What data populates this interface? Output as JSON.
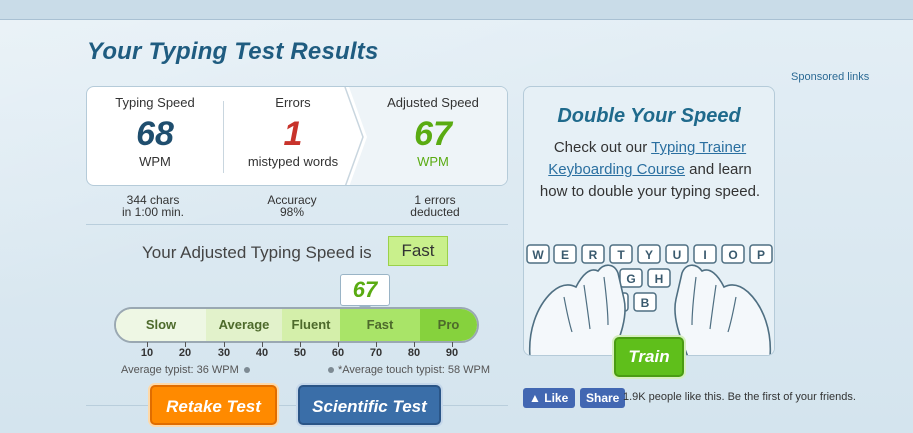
{
  "page": {
    "title": "Your Typing Test Results",
    "sponsored_links": "Sponsored links"
  },
  "results": {
    "typing_speed": {
      "label": "Typing Speed",
      "value": "68",
      "unit": "WPM",
      "color": "#1f4e6e"
    },
    "errors": {
      "label": "Errors",
      "value": "1",
      "unit": "mistyped words",
      "color": "#c8332b"
    },
    "adjusted_speed": {
      "label": "Adjusted Speed",
      "value": "67",
      "unit": "WPM",
      "color": "#5aab12"
    }
  },
  "details": {
    "chars_line1": "344 chars",
    "chars_line2": "in 1:00 min.",
    "accuracy_line1": "Accuracy",
    "accuracy_line2": "98%",
    "deducted_line1": "1 errors",
    "deducted_line2": "deducted"
  },
  "rating": {
    "label": "Your Adjusted Typing Speed is",
    "value": "Fast",
    "marker_value": "67"
  },
  "scale": {
    "segments": [
      "Slow",
      "Average",
      "Fluent",
      "Fast",
      "Pro"
    ],
    "ticks": [
      "10",
      "20",
      "30",
      "40",
      "50",
      "60",
      "70",
      "80",
      "90"
    ],
    "average_typist": "Average typist: 36 WPM",
    "average_touch_typist": "*Average touch typist: 58 WPM"
  },
  "buttons": {
    "retake": "Retake Test",
    "scientific": "Scientific Test"
  },
  "promo": {
    "title": "Double Your Speed",
    "text_before": "Check out our ",
    "link1": "Typing Trainer",
    "link2": "Keyboarding Course",
    "text_after": " and learn how to double your typing speed.",
    "keys_row1": [
      "W",
      "E",
      "R",
      "T",
      "Y",
      "U",
      "I",
      "O",
      "P"
    ],
    "keys_row2": [
      "G",
      "H"
    ],
    "keys_row3": [
      "V",
      "B"
    ],
    "train_button": "Train"
  },
  "social": {
    "like": "Like",
    "share": "Share",
    "text": "1.9K people like this. Be the first of your friends."
  },
  "colors": {
    "title": "#1f5c80",
    "retake_button": "#ff8a00",
    "scientific_button": "#3a6ea8",
    "train_button": "#5fbf1b",
    "facebook": "#4267b2"
  }
}
